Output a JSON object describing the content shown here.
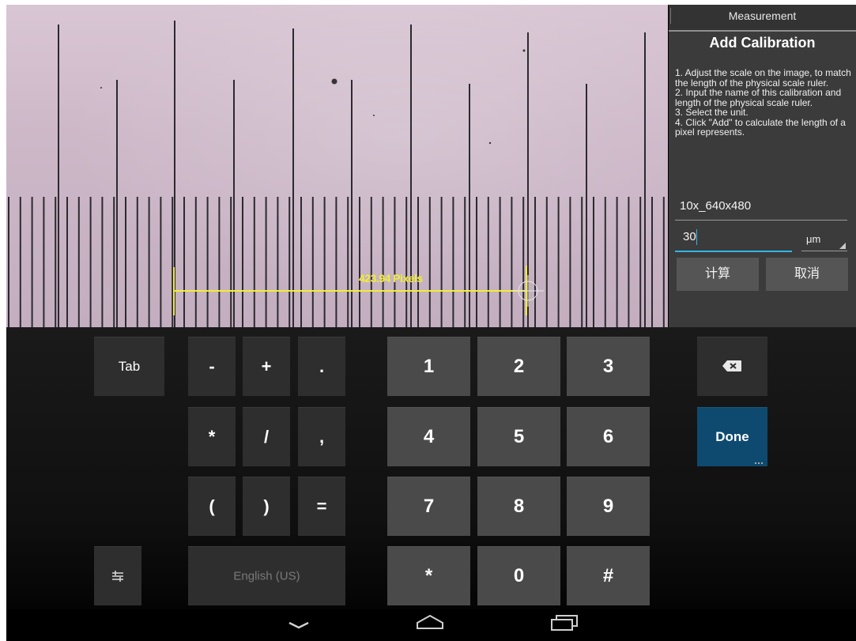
{
  "image_view": {
    "measurement_label": "423.94 Pixels"
  },
  "panel": {
    "tab_label": "Measurement",
    "title": "Add Calibration",
    "instructions": [
      "1. Adjust the scale on the image, to match the length of the physical scale ruler.",
      " 2. Input the name of this calibration and length of the physical scale ruler.",
      " 3. Select the unit.",
      " 4. Click \"Add\" to calculate the length of a pixel represents."
    ],
    "calibration_name": "10x_640x480",
    "length_value": "30",
    "unit": "μm",
    "calculate_label": "计算",
    "cancel_label": "取消"
  },
  "keyboard": {
    "tab": "Tab",
    "minus": "-",
    "plus": "+",
    "period": ".",
    "asterisk": "*",
    "slash": "/",
    "comma": ",",
    "lparen": "(",
    "rparen": ")",
    "equals": "=",
    "settings": "⚙",
    "language": "English (US)",
    "digits": [
      "1",
      "2",
      "3",
      "4",
      "5",
      "6",
      "7",
      "8",
      "9",
      "0"
    ],
    "star": "*",
    "hash": "#",
    "done": "Done"
  },
  "colors": {
    "accent": "#33b5e5",
    "measure_line": "#f1ee35",
    "done_key": "#0e4a6f"
  },
  "icons": {
    "backspace": "backspace-icon",
    "back": "chevron-down-icon",
    "home": "home-icon",
    "recents": "recents-icon",
    "settings": "keyboard-settings-icon"
  }
}
